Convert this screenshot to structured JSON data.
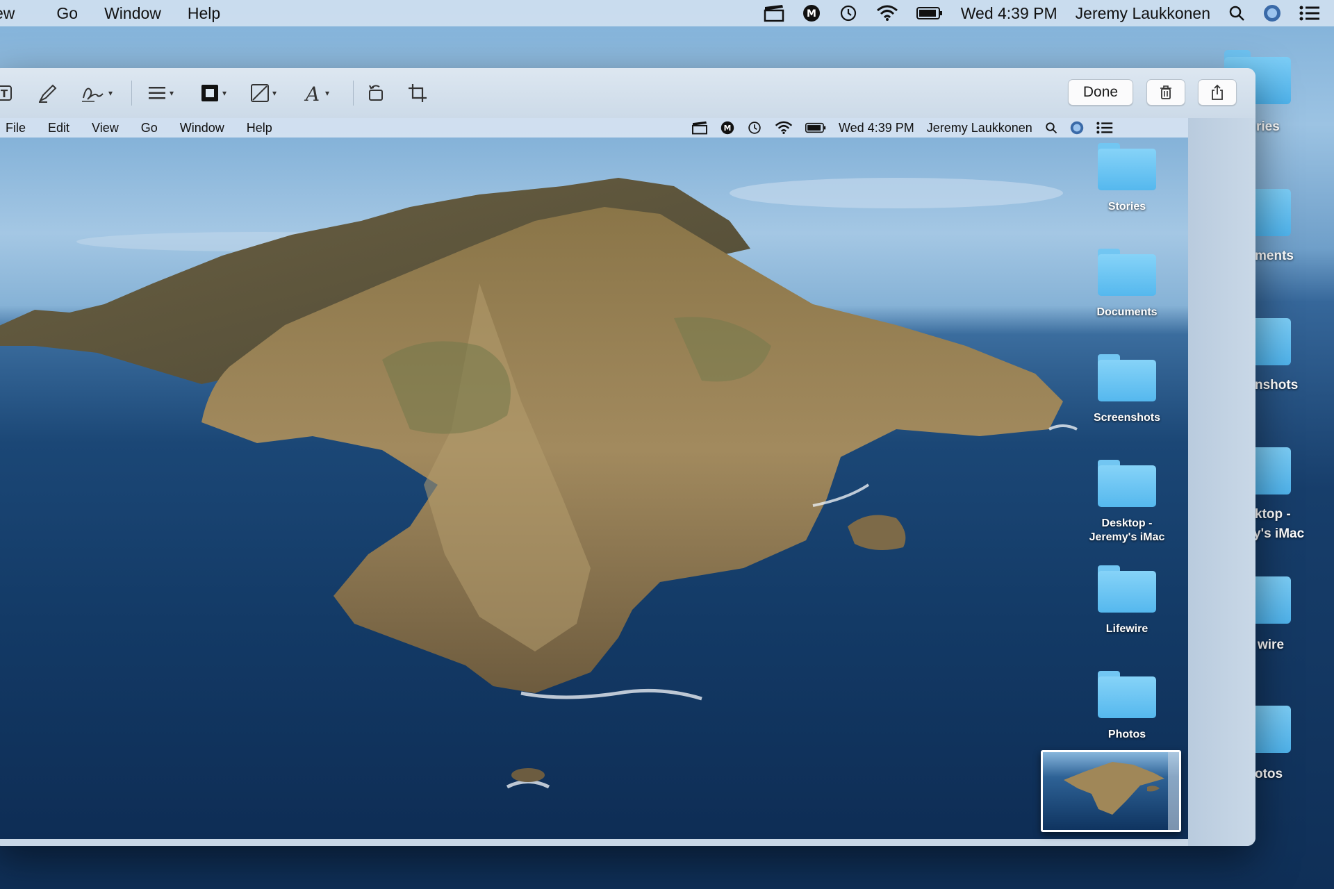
{
  "outer_menubar": {
    "menus": [
      "ew",
      "Go",
      "Window",
      "Help"
    ],
    "clock": "Wed 4:39 PM",
    "user": "Jeremy Laukkonen"
  },
  "outer_desktop_labels": [
    "ries",
    "ments",
    "nshots",
    "ktop -",
    "y's iMac",
    "wire",
    "otos"
  ],
  "toolbar": {
    "done_label": "Done"
  },
  "inner_menubar": {
    "menus": [
      "File",
      "Edit",
      "View",
      "Go",
      "Window",
      "Help"
    ],
    "clock": "Wed 4:39 PM",
    "user": "Jeremy Laukkonen"
  },
  "desktop_folders": [
    {
      "label": "Stories"
    },
    {
      "label": "Documents"
    },
    {
      "label": "Screenshots"
    },
    {
      "label": "Desktop -\nJeremy's iMac"
    },
    {
      "label": "Lifewire"
    },
    {
      "label": "Photos"
    }
  ]
}
